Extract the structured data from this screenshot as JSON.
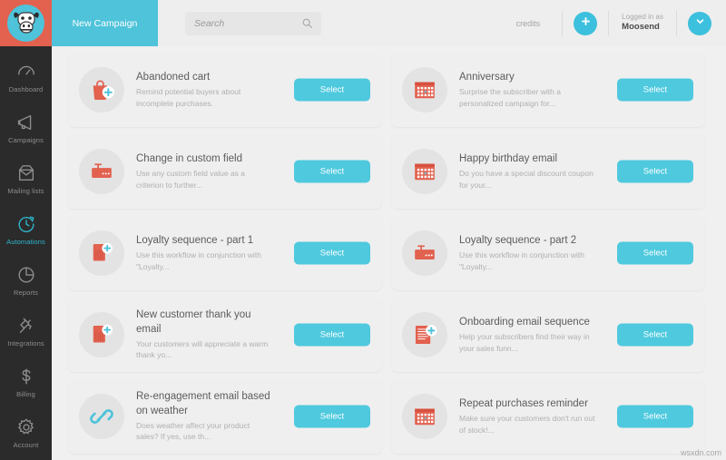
{
  "brand": {
    "logo_icon": "cow-face-logo",
    "logo_bg": "#e2614f",
    "logo_circle": "#4ec3da",
    "accent": "#4ec3da",
    "accent_button": "#4ec9de",
    "red": "#e2614f"
  },
  "topbar": {
    "new_campaign_label": "New Campaign",
    "search": {
      "placeholder": "Search",
      "value": "",
      "icon": "search-icon"
    },
    "credits_label": "credits",
    "add_credits_icon": "plus-icon",
    "logged_in_label": "Logged in as",
    "account_name": "Moosend",
    "account_menu_icon": "chevron-down-icon"
  },
  "sidebar": {
    "items": [
      {
        "label": "Dashboard",
        "icon": "gauge-icon",
        "active": false
      },
      {
        "label": "Campaigns",
        "icon": "megaphone-icon",
        "active": false
      },
      {
        "label": "Mailing lists",
        "icon": "envelope-icon",
        "active": false
      },
      {
        "label": "Automations",
        "icon": "clock-refresh-icon",
        "active": true
      },
      {
        "label": "Reports",
        "icon": "pie-chart-icon",
        "active": false
      },
      {
        "label": "Integrations",
        "icon": "plug-icon",
        "active": false
      },
      {
        "label": "Billing",
        "icon": "dollar-icon",
        "active": false
      },
      {
        "label": "Account",
        "icon": "gear-icon",
        "active": false
      }
    ]
  },
  "main": {
    "select_label": "Select",
    "recipes": [
      {
        "title": "Abandoned cart",
        "desc": "Remind potential buyers about incomplete purchases.",
        "icon": "shopping-bag-plus-icon"
      },
      {
        "title": "Anniversary",
        "desc": "Surprise the subscriber with a personalized campaign for...",
        "icon": "calendar-icon"
      },
      {
        "title": "Change in custom field",
        "desc": "Use any custom field value as a criterion to further...",
        "icon": "custom-field-icon"
      },
      {
        "title": "Happy birthday email",
        "desc": "Do you have a special discount coupon for your...",
        "icon": "calendar-icon"
      },
      {
        "title": "Loyalty sequence - part 1",
        "desc": "Use this workflow in conjunction with \"Loyalty...",
        "icon": "tag-plus-icon"
      },
      {
        "title": "Loyalty sequence - part 2",
        "desc": "Use this workflow in conjunction with \"Loyalty...",
        "icon": "custom-field-icon"
      },
      {
        "title": "New customer thank you email",
        "desc": "Your customers will appreciate a warm thank yo...",
        "icon": "tag-plus-icon"
      },
      {
        "title": "Onboarding email sequence",
        "desc": "Help your subscribers find their way in your sales funn...",
        "icon": "document-plus-icon"
      },
      {
        "title": "Re-engagement email based on weather",
        "desc": "Does weather affect your product sales? If yes, use th...",
        "icon": "link-chain-icon"
      },
      {
        "title": "Repeat purchases reminder",
        "desc": "Make sure your customers don't run out of stock!...",
        "icon": "calendar-icon"
      }
    ]
  },
  "watermark": "wsxdn.com"
}
